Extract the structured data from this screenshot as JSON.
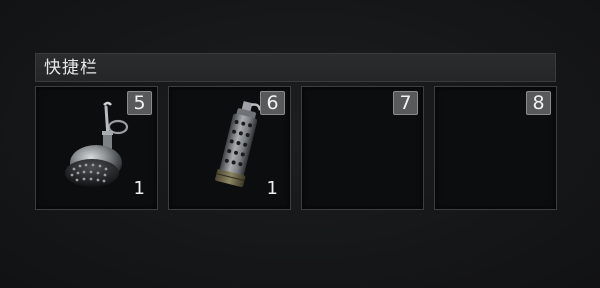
{
  "quickbar": {
    "title": "快捷栏",
    "slots": [
      {
        "key": "5",
        "count": "1",
        "item_icon": "flashbang-grenade-icon"
      },
      {
        "key": "6",
        "count": "1",
        "item_icon": "smoke-grenade-icon"
      },
      {
        "key": "7",
        "count": "",
        "item_icon": ""
      },
      {
        "key": "8",
        "count": "",
        "item_icon": ""
      }
    ]
  },
  "colors": {
    "background": "#151617",
    "slot_background": "#0c0d0e",
    "slot_border": "#3d3e40",
    "key_badge": "#58595b",
    "text": "#f0f0f0"
  }
}
